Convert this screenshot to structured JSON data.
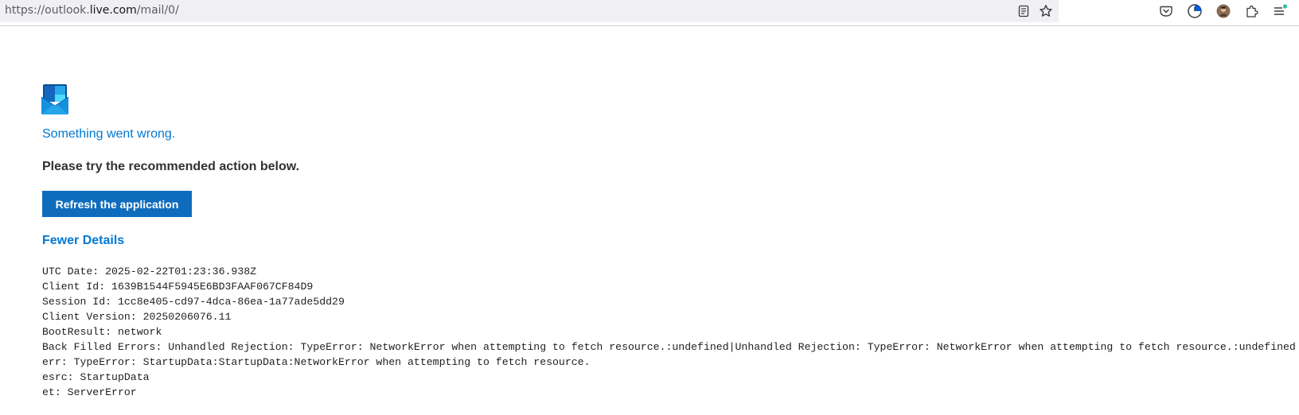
{
  "browser": {
    "url_prefix": "https://outlook.",
    "url_host": "live.com",
    "url_suffix": "/mail/0/",
    "icons": [
      "reader-view-icon",
      "bookmark-star-icon",
      "pocket-icon",
      "clock-icon",
      "profile-avatar-icon",
      "extensions-icon",
      "menu-icon"
    ]
  },
  "error": {
    "title": "Something went wrong.",
    "subtitle": "Please try the recommended action below.",
    "refresh_label": "Refresh the application",
    "details_toggle": "Fewer Details",
    "details": [
      "UTC Date: 2025-02-22T01:23:36.938Z",
      "Client Id: 1639B1544F5945E6BD3FAAF067CF84D9",
      "Session Id: 1cc8e405-cd97-4dca-86ea-1a77ade5dd29",
      "Client Version: 20250206076.11",
      "BootResult: network",
      "Back Filled Errors: Unhandled Rejection: TypeError: NetworkError when attempting to fetch resource.:undefined|Unhandled Rejection: TypeError: NetworkError when attempting to fetch resource.:undefined",
      "err: TypeError: StartupData:StartupData:NetworkError when attempting to fetch resource.",
      "esrc: StartupData",
      "et: ServerError"
    ]
  },
  "colors": {
    "accent": "#0078d4",
    "button": "#0f6cbd"
  }
}
